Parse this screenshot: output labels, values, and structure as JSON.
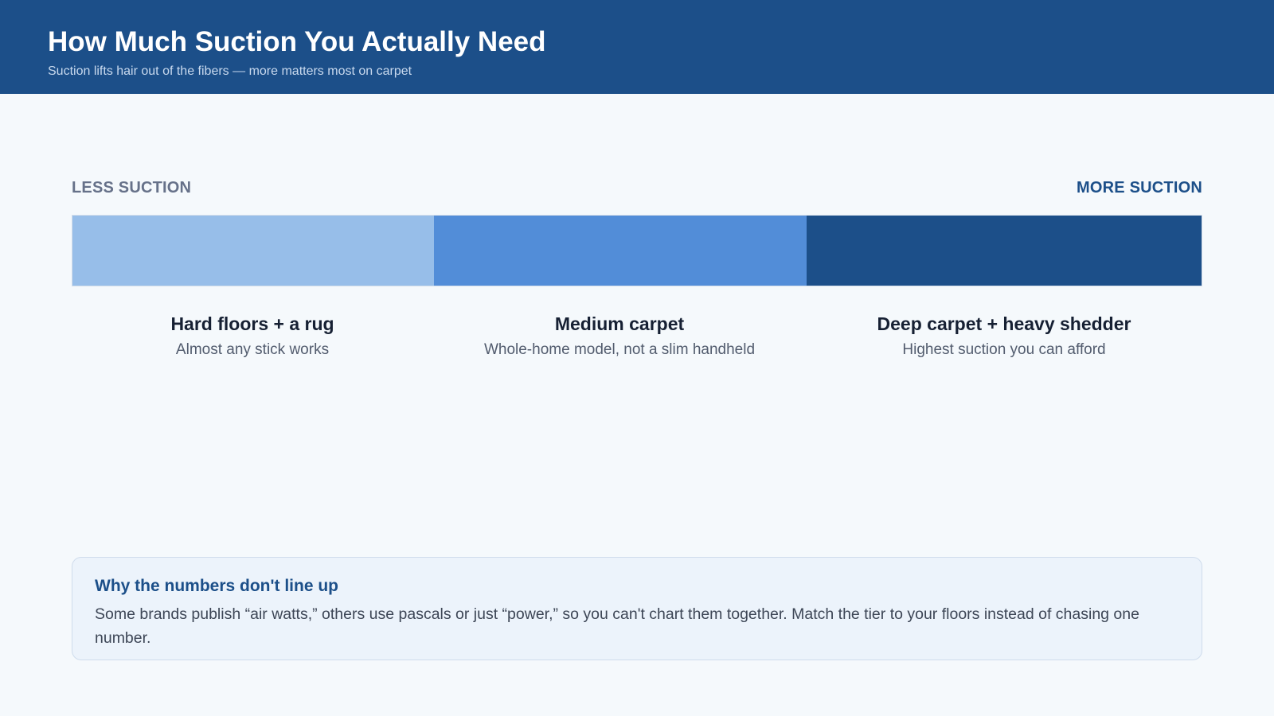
{
  "header": {
    "title": "How Much Suction You Actually Need",
    "subtitle": "Suction lifts hair out of the fibers — more matters most on carpet"
  },
  "scale": {
    "low_label": "LESS SUCTION",
    "high_label": "MORE SUCTION"
  },
  "tiers": [
    {
      "title": "Hard floors + a rug",
      "description": "Almost any stick works",
      "color": "#97bee9"
    },
    {
      "title": "Medium carpet",
      "description": "Whole-home model, not a slim handheld",
      "color": "#528dd8"
    },
    {
      "title": "Deep carpet + heavy shedder",
      "description": "Highest suction you can afford",
      "color": "#1c4f89"
    }
  ],
  "note": {
    "title": "Why the numbers don't line up",
    "body": "Some brands publish “air watts,” others use pascals or just “power,” so you can't chart them together. Match the tier to your floors instead of chasing one number."
  },
  "colors": {
    "header_bg": "#1c4f89",
    "page_bg": "#f5f9fc",
    "accent": "#1c4f89"
  }
}
